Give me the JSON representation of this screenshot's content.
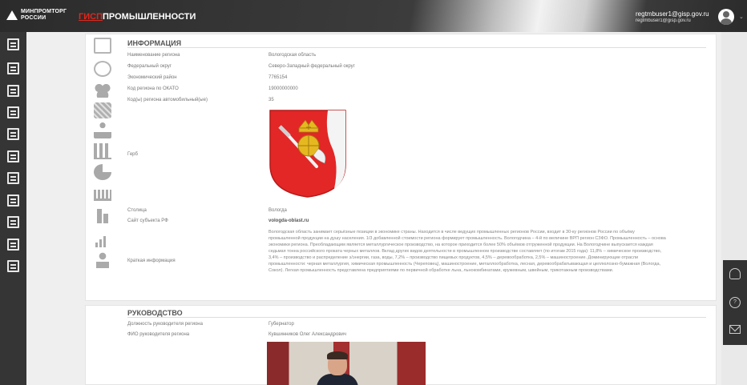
{
  "header": {
    "logo_text": "МИНПРОМТОРГ РОССИИ",
    "brand_prefix": "ГИСП",
    "brand_suffix": " ПРОМЫШЛЕННОСТИ",
    "user_email": "regtmbuser1@gisp.gov.ru",
    "user_sub": "regtmbuser1@gisp.gov.ru",
    "user_chevron": "⌄"
  },
  "sidebar": {
    "items": [
      {
        "icon": "grid-icon"
      },
      {
        "icon": "buildings-icon"
      },
      {
        "icon": "document-icon"
      },
      {
        "icon": "import-icon"
      },
      {
        "icon": "plane-icon"
      },
      {
        "icon": "calendar-icon"
      },
      {
        "icon": "report-icon"
      },
      {
        "icon": "star-icon"
      },
      {
        "icon": "barcode-icon"
      },
      {
        "icon": "list-icon"
      },
      {
        "icon": "id-card-icon"
      }
    ]
  },
  "info": {
    "title": "ИНФОРМАЦИЯ",
    "rows": [
      {
        "label": "Наименование региона",
        "value": "Вологодская область"
      },
      {
        "label": "Федеральный округ",
        "value": "Северо-Западный федеральный округ"
      },
      {
        "label": "Экономический район",
        "value": "7765154"
      },
      {
        "label": "Код региона по ОКАТО",
        "value": "19000000000"
      },
      {
        "label": "Код(ы) региона автомобильный(ые)",
        "value": "35"
      }
    ],
    "coat_label": "Герб",
    "capital_label": "Столица",
    "capital_value": "Вологда",
    "site_label": "Сайт субъекта РФ",
    "site_value": "vologda-oblast.ru",
    "short_label": "Краткая информация",
    "short_text": "Вологодская область занимает серьёзные позиции в экономике страны. Находится в числе ведущих промышленных регионов России, входит в 30-ку регионов России по объёму промышленной продукции на душу населения. 1/3 добавленной стоимости региона формирует промышленность. Вологодчина – 4-й по величине ВРП регион СЗФО. Промышленность – основа экономики региона. Преобладающим является металлургическое производство, на которое приходится более 50% объёмов отгруженной продукции. На Вологодчине выпускается каждая седьмая тонна российского проката черных металлов. Вклад других видов деятельности в промышленном производстве составляет (по итогам 2015 года): 11,8% – химическое производство, 3,4% – производство и распределение э/энергии, газа, воды, 7,2% – производство пищевых продуктов, 4,5% – деревообработка, 2,5% – машиностроение. Доминирующие отрасли промышленности: черная металлургия, химическая промышленность (Череповец), машиностроение, металлообработка, лесная, деревообрабатывающая и целлюлозно-бумажная (Вологда, Сокол). Легкая промышленность представлена предприятиями по первичной обработке льна, льнокомбинатами, кружевным, швейным, трикотажным производствами."
  },
  "leadership": {
    "title": "РУКОВОДСТВО",
    "rows": [
      {
        "label": "Должность руководителя региона",
        "value": "Губернатор"
      },
      {
        "label": "ФИО руководителя региона",
        "value": "Кувшинников Олег Александрович"
      }
    ]
  },
  "floating": {
    "help_glyph": "?"
  },
  "colors": {
    "header_dark": "#2b2b2b",
    "brand_red": "#e1261c",
    "sidebar": "#353535",
    "coat_red": "#e32626",
    "crown_gold": "#e6b820"
  }
}
